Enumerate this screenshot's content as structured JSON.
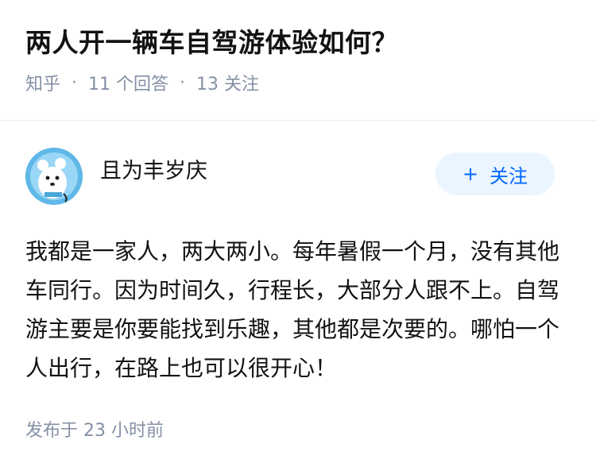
{
  "question": {
    "title": "两人开一辆车自驾游体验如何？",
    "source": "知乎",
    "separator": "·",
    "answers_count": "11 个回答",
    "followers_count": "13 关注"
  },
  "answer": {
    "author": "且为丰岁庆",
    "avatar_icon": "cartoon-bear-avatar-icon",
    "follow_plus": "+",
    "follow_label": "关注",
    "content": "我都是一家人，两大两小。每年暑假一个月，没有其他车同行。因为时间久，行程长，大部分人跟不上。自驾游主要是你要能找到乐趣，其他都是次要的。哪怕一个人出行，在路上也可以很开心！",
    "published": "发布于 23 小时前"
  },
  "colors": {
    "accent": "#0066ff",
    "follow_bg": "#ebf5ff",
    "meta_text": "#8590a6",
    "avatar_bg": "#5fb8e8"
  }
}
